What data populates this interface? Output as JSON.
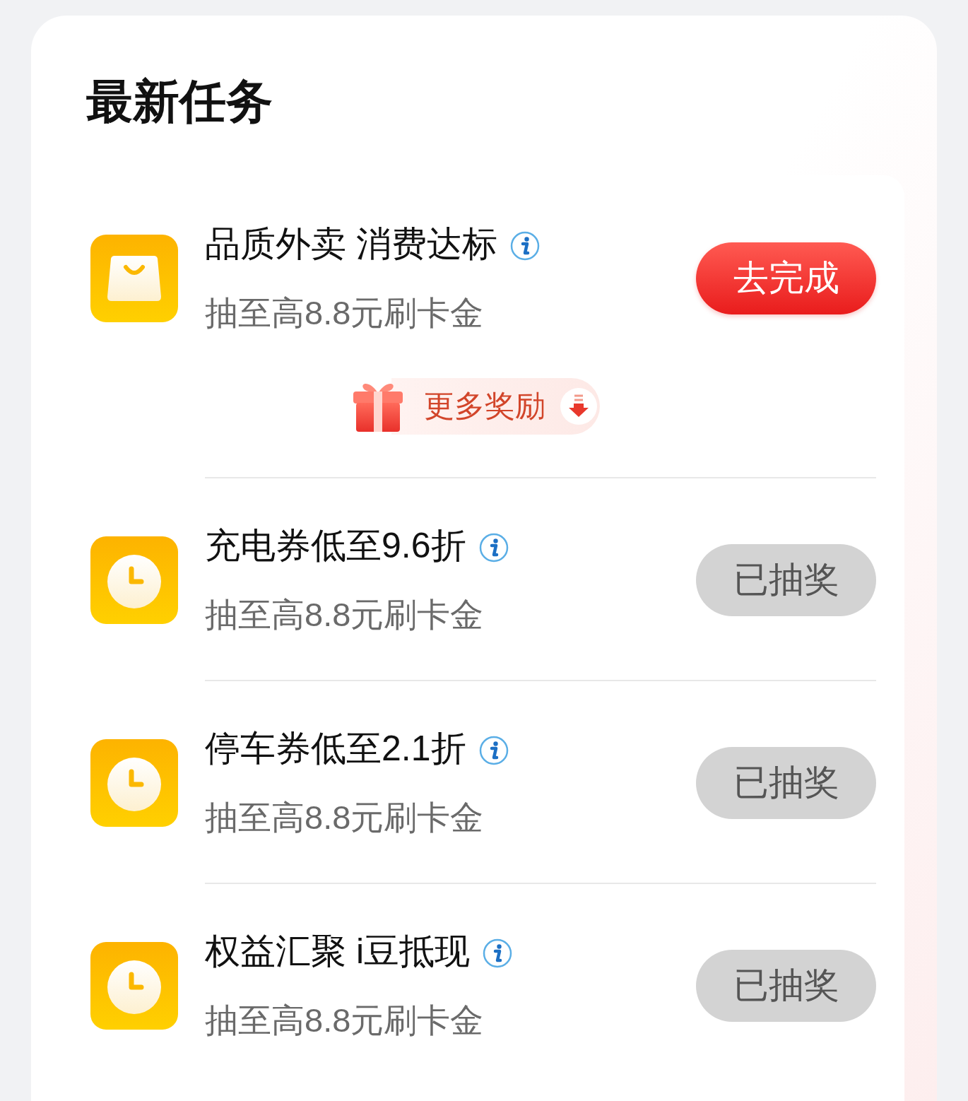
{
  "title": "最新任务",
  "tasks": [
    {
      "kind": "bag",
      "title": "品质外卖 消费达标",
      "subtitle": "抽至高8.8元刷卡金",
      "button": "去完成",
      "claimed": false,
      "more_rewards": "更多奖励"
    },
    {
      "kind": "clock",
      "title": "充电券低至9.6折",
      "subtitle": "抽至高8.8元刷卡金",
      "button": "已抽奖",
      "claimed": true
    },
    {
      "kind": "clock",
      "title": "停车券低至2.1折",
      "subtitle": "抽至高8.8元刷卡金",
      "button": "已抽奖",
      "claimed": true
    },
    {
      "kind": "clock",
      "title": "权益汇聚 i豆抵现",
      "subtitle": "抽至高8.8元刷卡金",
      "button": "已抽奖",
      "claimed": true
    }
  ]
}
